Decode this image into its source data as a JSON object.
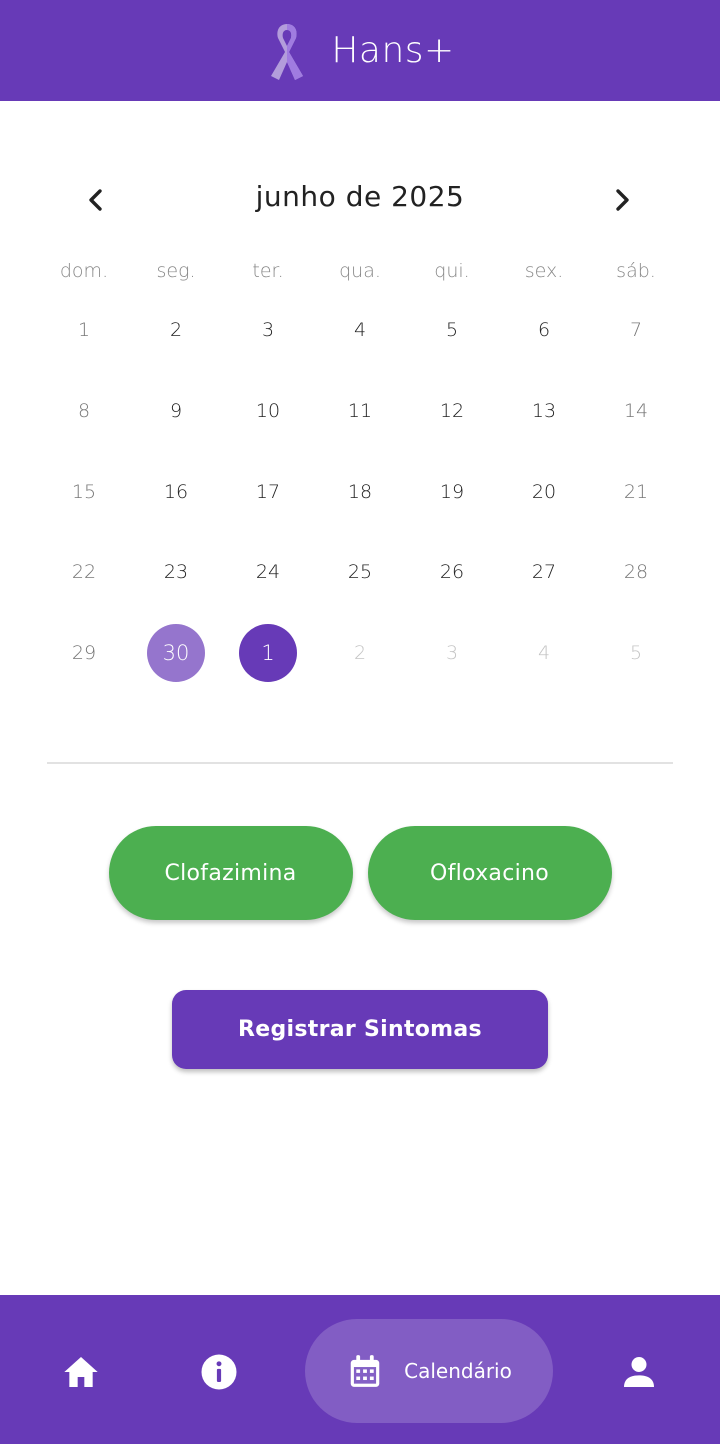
{
  "app_bar": {
    "title": "Hans+",
    "logo_icon": "awareness-ribbon-icon",
    "background": "#673ab7"
  },
  "calendar": {
    "month_title": "junho de 2025",
    "weekdays": [
      "dom.",
      "seg.",
      "ter.",
      "qua.",
      "qui.",
      "sex.",
      "sáb."
    ],
    "weeks": [
      [
        "1",
        "2",
        "3",
        "4",
        "5",
        "6",
        "7"
      ],
      [
        "8",
        "9",
        "10",
        "11",
        "12",
        "13",
        "14"
      ],
      [
        "15",
        "16",
        "17",
        "18",
        "19",
        "20",
        "21"
      ],
      [
        "22",
        "23",
        "24",
        "25",
        "26",
        "27",
        "28"
      ],
      [
        "29",
        "30",
        "1",
        "2",
        "3",
        "4",
        "5"
      ]
    ],
    "selected_day": "30",
    "today_day": "1",
    "selected_color": "#9575cd",
    "today_color": "#673ab7"
  },
  "medications": [
    {
      "label": "Clofazimina"
    },
    {
      "label": "Ofloxacino"
    }
  ],
  "medication_color": "#4caf50",
  "symptoms_button": {
    "label": "Registrar Sintomas"
  },
  "bottom_nav": {
    "items": [
      {
        "icon": "home-icon"
      },
      {
        "icon": "info-icon"
      },
      {
        "icon": "calendar-icon",
        "label": "Calendário",
        "active": true
      },
      {
        "icon": "person-icon"
      }
    ]
  }
}
